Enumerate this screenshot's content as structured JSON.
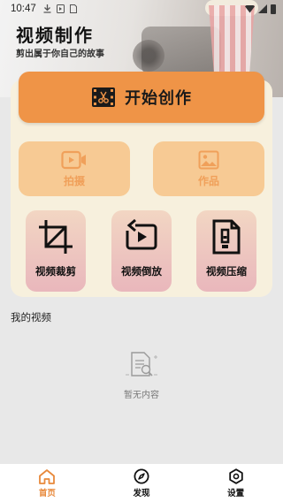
{
  "status_bar": {
    "time": "10:47"
  },
  "header": {
    "title": "视频制作",
    "subtitle": "剪出属于你自己的故事"
  },
  "main": {
    "start_button": "开始创作",
    "tiles": [
      {
        "label": "拍摄",
        "icon": "video-camera-icon"
      },
      {
        "label": "作品",
        "icon": "image-icon"
      }
    ],
    "tools": [
      {
        "label": "视频裁剪",
        "icon": "crop-icon"
      },
      {
        "label": "视频倒放",
        "icon": "reverse-play-icon"
      },
      {
        "label": "视频压缩",
        "icon": "compress-file-icon"
      }
    ]
  },
  "my_videos": {
    "title": "我的视频",
    "empty_text": "暂无内容"
  },
  "bottom_nav": [
    {
      "label": "首页",
      "icon": "home-icon",
      "active": true
    },
    {
      "label": "发现",
      "icon": "compass-icon",
      "active": false
    },
    {
      "label": "设置",
      "icon": "settings-icon",
      "active": false
    }
  ],
  "colors": {
    "accent": "#ef9447",
    "tile": "#f7ca94",
    "card": "#f7f0dd",
    "nav_active": "#e8893b"
  }
}
